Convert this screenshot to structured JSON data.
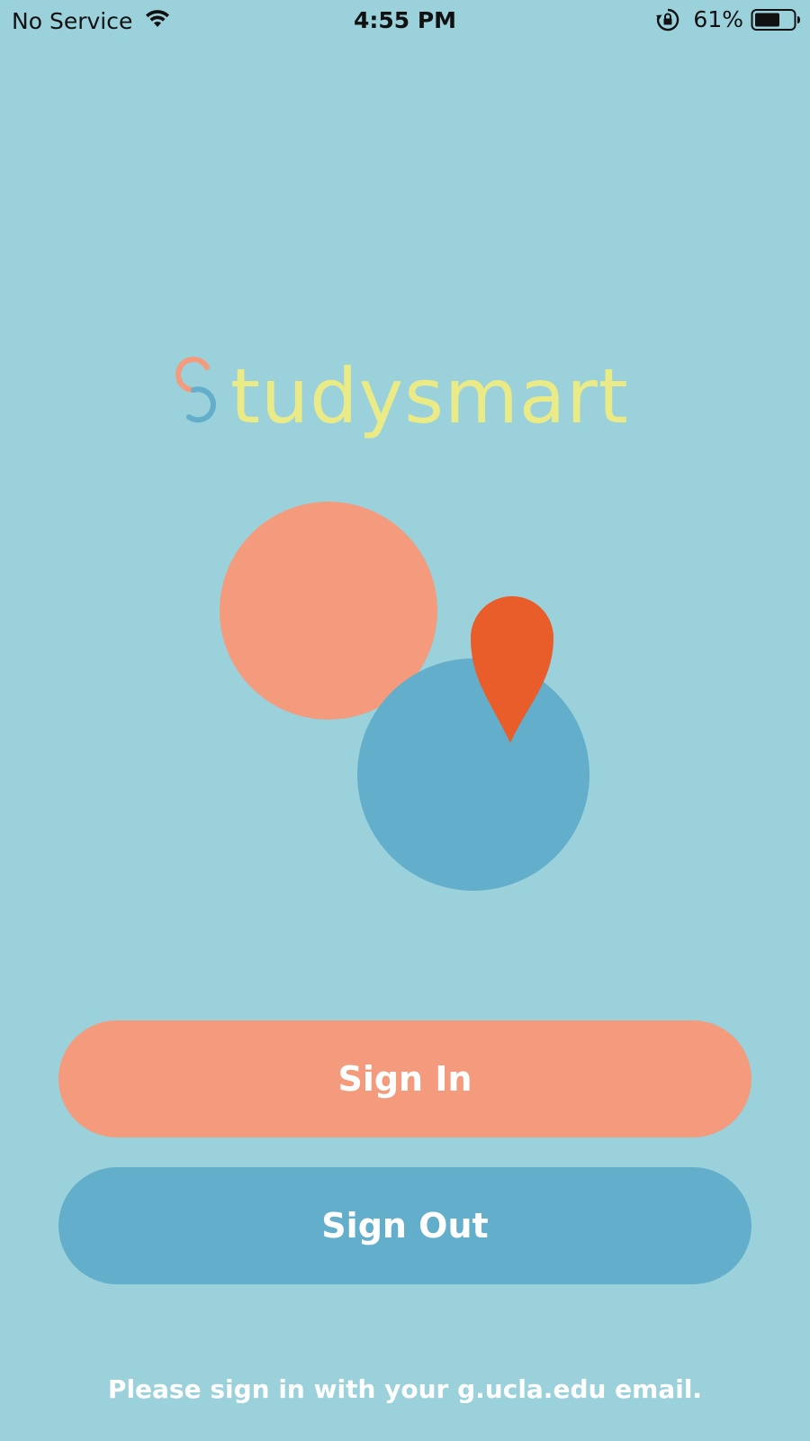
{
  "status_bar": {
    "carrier": "No Service",
    "time": "4:55 PM",
    "battery_percent": "61%",
    "icons": [
      "wifi-icon",
      "rotation-lock-icon",
      "battery-icon"
    ]
  },
  "logo": {
    "first_letter": "S",
    "wordmark_rest": "tudysmart",
    "colors": {
      "wordmark": "#eaeb86",
      "s_top": "#f39b7c",
      "s_bottom": "#63aecb"
    }
  },
  "illustration": {
    "colors": {
      "salmon_circle": "#f39b7c",
      "blue_circle": "#63aecb",
      "pin": "#e85d2a"
    }
  },
  "buttons": {
    "sign_in": "Sign In",
    "sign_out": "Sign Out"
  },
  "footer": {
    "note": "Please sign in with your g.ucla.edu email."
  },
  "colors": {
    "background": "#9bd1db",
    "sign_in_bg": "#f39b7c",
    "sign_out_bg": "#63aecb"
  }
}
